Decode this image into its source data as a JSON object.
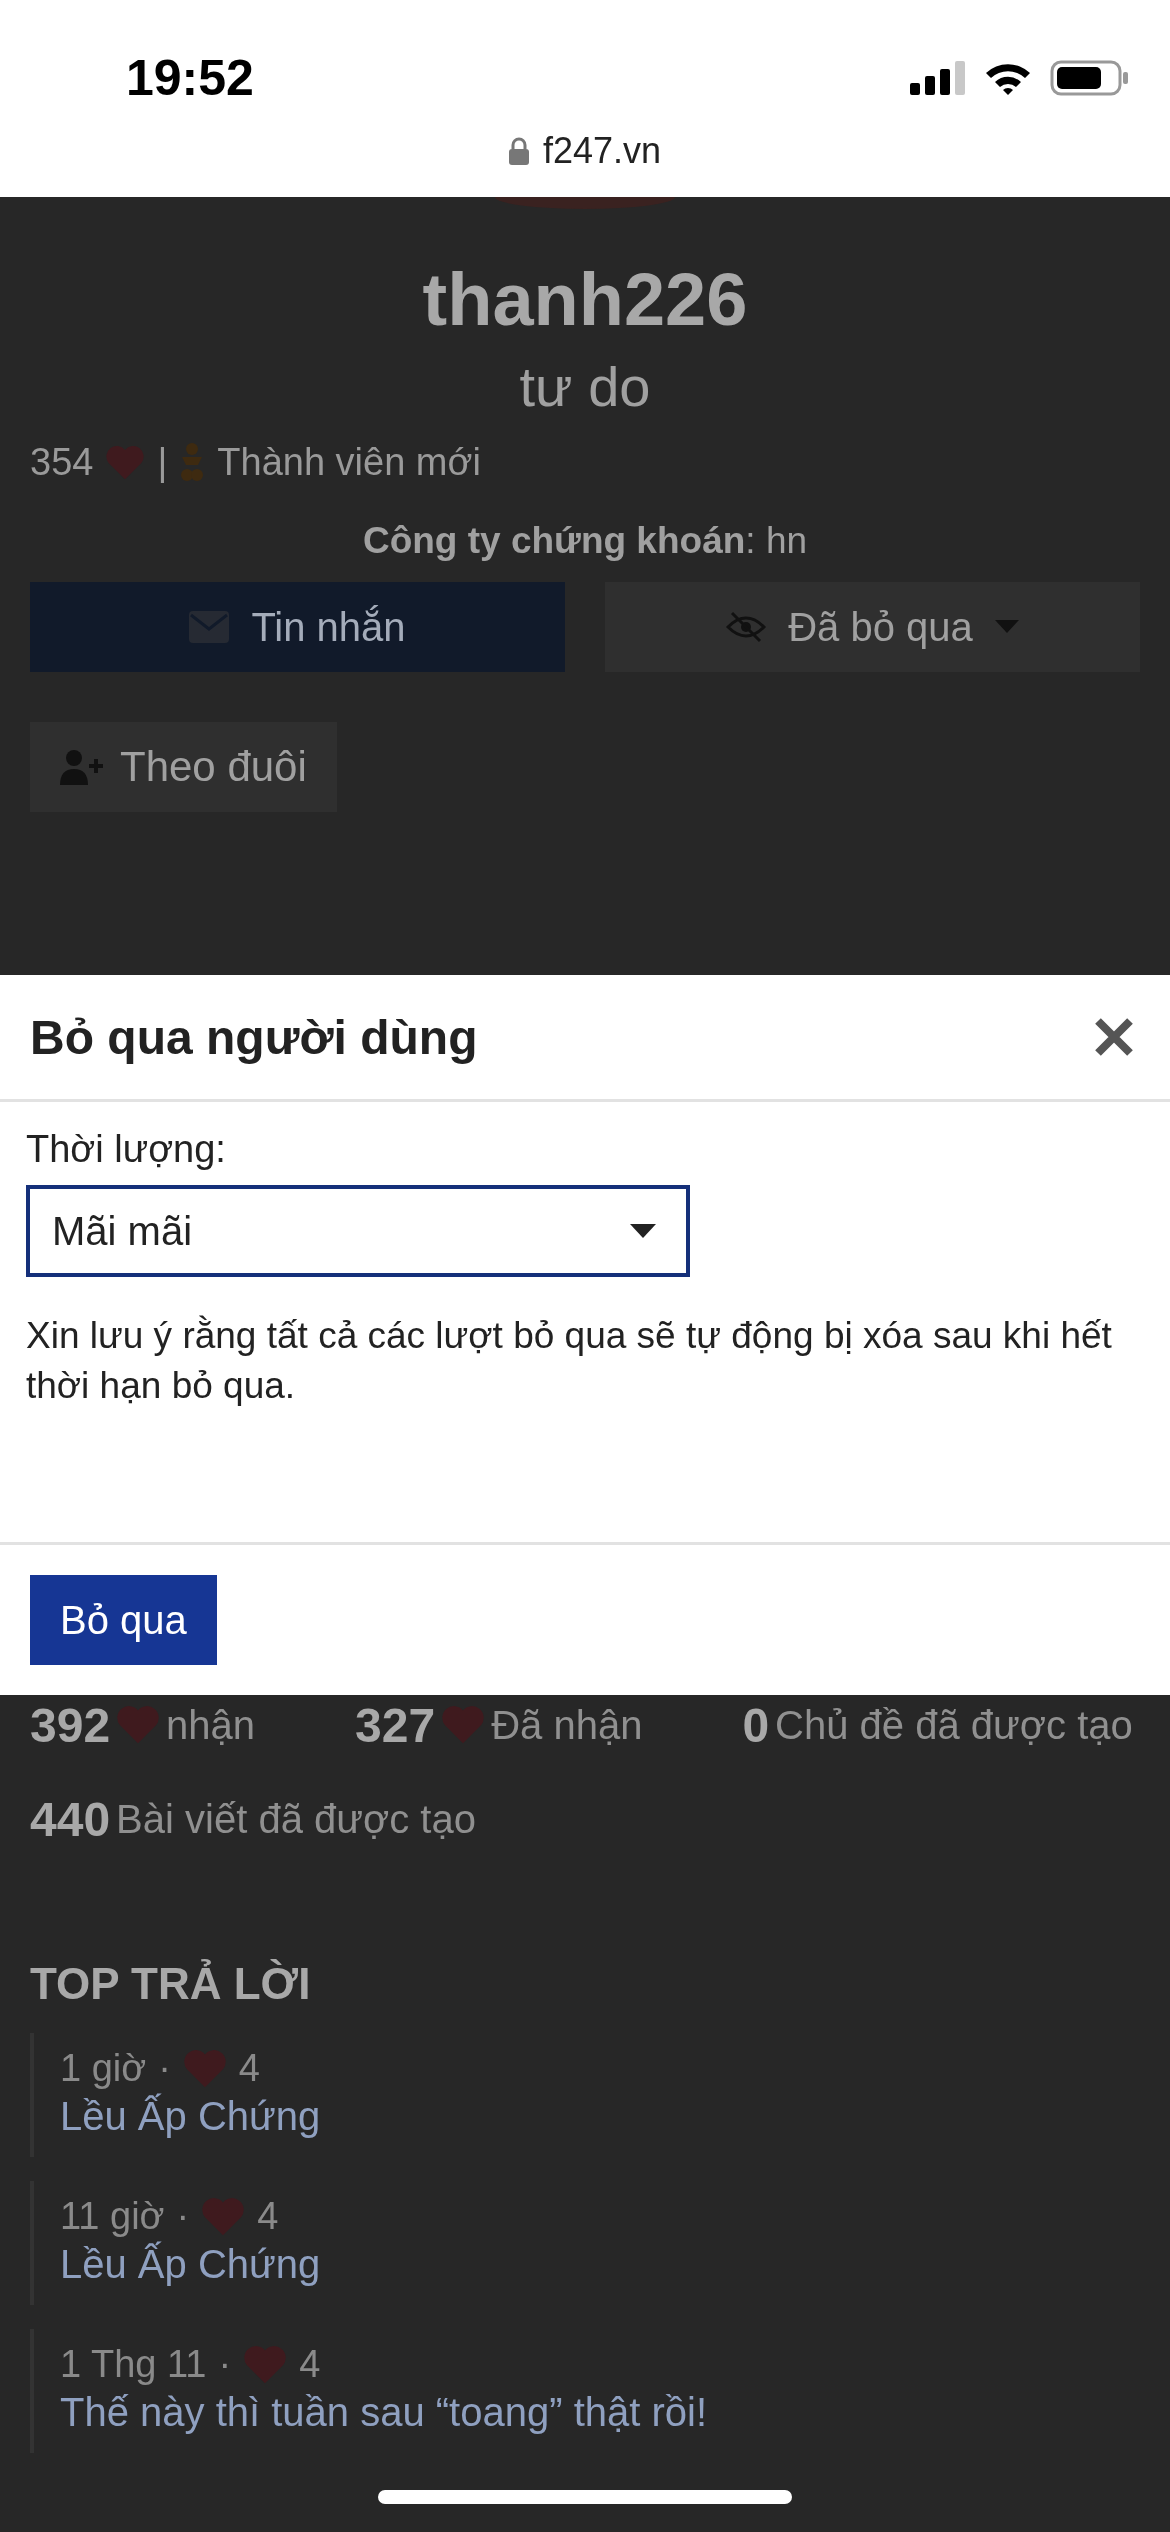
{
  "status_bar": {
    "time": "19:52"
  },
  "browser": {
    "url": "f247.vn"
  },
  "profile": {
    "username": "thanh226",
    "title": "tư do",
    "likes": "354",
    "separator": "|",
    "rank": "Thành viên mới",
    "company": "**Công ty chứng khoán**: hn",
    "buttons": [
      {
        "label": "Tin nhắn",
        "kind": "message"
      },
      {
        "label": "Đã bỏ qua",
        "kind": "ignored"
      }
    ],
    "follow_button": "Theo đuôi"
  },
  "modal": {
    "title": "Bỏ qua người dùng",
    "duration_label": "Thời lượng:",
    "duration_value": "Mãi mãi",
    "note": "Xin lưu ý rằng tất cả các lượt bỏ qua sẽ tự động bị xóa sau khi hết thời hạn bỏ qua.",
    "submit": "Bỏ qua"
  },
  "stats": [
    {
      "value": "392",
      "label": "nhận",
      "kind": "heart"
    },
    {
      "value": "327",
      "label": "Đã nhận",
      "kind": "heart"
    },
    {
      "value": "0",
      "label": "Chủ đề đã được tạo",
      "kind": "plain"
    },
    {
      "value": "440",
      "label": "Bài viết đã được tạo",
      "kind": "plain"
    }
  ],
  "top_replies": {
    "heading": "TOP TRẢ LỜI",
    "separator": "·",
    "items": [
      {
        "time": "1 giờ",
        "likes": "4",
        "title": "Lều Ấp Chứng"
      },
      {
        "time": "11 giờ",
        "likes": "4",
        "title": "Lều Ấp Chứng"
      },
      {
        "time": "1 Thg 11",
        "likes": "4",
        "title": "Thế này thì tuần sau “toang” thật rồi!"
      }
    ]
  }
}
